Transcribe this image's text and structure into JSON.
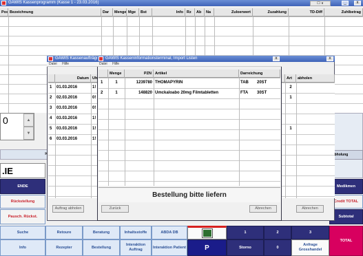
{
  "main_window": {
    "title": "GAWIS Kassenprogramm (Kasse 1 - 23.03.2016)",
    "columns": [
      "Pos",
      "Bezeichnung",
      "Dar",
      "Menge",
      "Mge",
      "Bst",
      "Info",
      "Rz",
      "Ab",
      "Na",
      "Zuloerwert",
      "Zuzahlung",
      "TD-Diff",
      "Zuhlbetrag"
    ],
    "qty_value": "0",
    "search_text": ".IE",
    "right_header": "Abholung"
  },
  "left_window": {
    "title": "GAWIS Kassenaufträge",
    "menu": [
      "Datei",
      "Hilfe"
    ],
    "columns": [
      "Datum",
      "Uhr"
    ],
    "rows": [
      {
        "idx": "1",
        "date": "01.03.2016",
        "time": "1!"
      },
      {
        "idx": "2",
        "date": "02.03.2016",
        "time": "0!"
      },
      {
        "idx": "3",
        "date": "03.03.2016",
        "time": "0!"
      },
      {
        "idx": "4",
        "date": "03.03.2016",
        "time": "1!"
      },
      {
        "idx": "5",
        "date": "03.03.2016",
        "time": "1!"
      },
      {
        "idx": "6",
        "date": "03.03.2016",
        "time": "1!"
      }
    ],
    "footer_button": "Auftrag abholen",
    "side_label": "Kun"
  },
  "right_window": {
    "columns": [
      "Art",
      "abholen"
    ],
    "rows": [
      {
        "art": "2",
        "abholen": ""
      },
      {
        "art": "1",
        "abholen": ""
      },
      {
        "art": "",
        "abholen": ""
      },
      {
        "art": "",
        "abholen": ""
      },
      {
        "art": "1",
        "abholen": ""
      },
      {
        "art": "",
        "abholen": ""
      }
    ],
    "footer_button": "Abrechen"
  },
  "dialog": {
    "title": "GAWIS Kasseninformationsterminal, Import Listen",
    "menu": [
      "Datei",
      "Hilfe"
    ],
    "columns": [
      "Menge",
      "PZN",
      "Artikel",
      "Darreichung"
    ],
    "rows": [
      {
        "pos": "1",
        "menge": "1",
        "pzn": "1239780",
        "artikel": "THOMAPYRIN",
        "dar": "TAB",
        "size": "20ST"
      },
      {
        "pos": "2",
        "menge": "1",
        "pzn": "148820",
        "artikel": "Umckaloabo 20mg Filmtabletten",
        "dar": "FTA",
        "size": "30ST"
      }
    ],
    "status": "Bestellung bitte liefern",
    "left_button": "Zurück",
    "right_button": "Abrechen"
  },
  "left_buttons": [
    "ENDE",
    "Rückstellung",
    "Pausch. Rückst."
  ],
  "right_buttons": [
    "Medikmen",
    "Credit TOTAL",
    "Subtotal"
  ],
  "bottom_row1": [
    "Suche",
    "Retoure",
    "Beratung",
    "Inhaltsstoffe",
    "ABDA DB",
    "",
    "1",
    "2",
    "3"
  ],
  "bottom_row2": [
    "Info",
    "Rezepter",
    "Bestellung",
    "Interaktion Auftrag",
    "Interaktion Patient",
    "P",
    "Storno",
    "0",
    "Anfrage Grosshandel"
  ],
  "total_label": "TOTAL"
}
